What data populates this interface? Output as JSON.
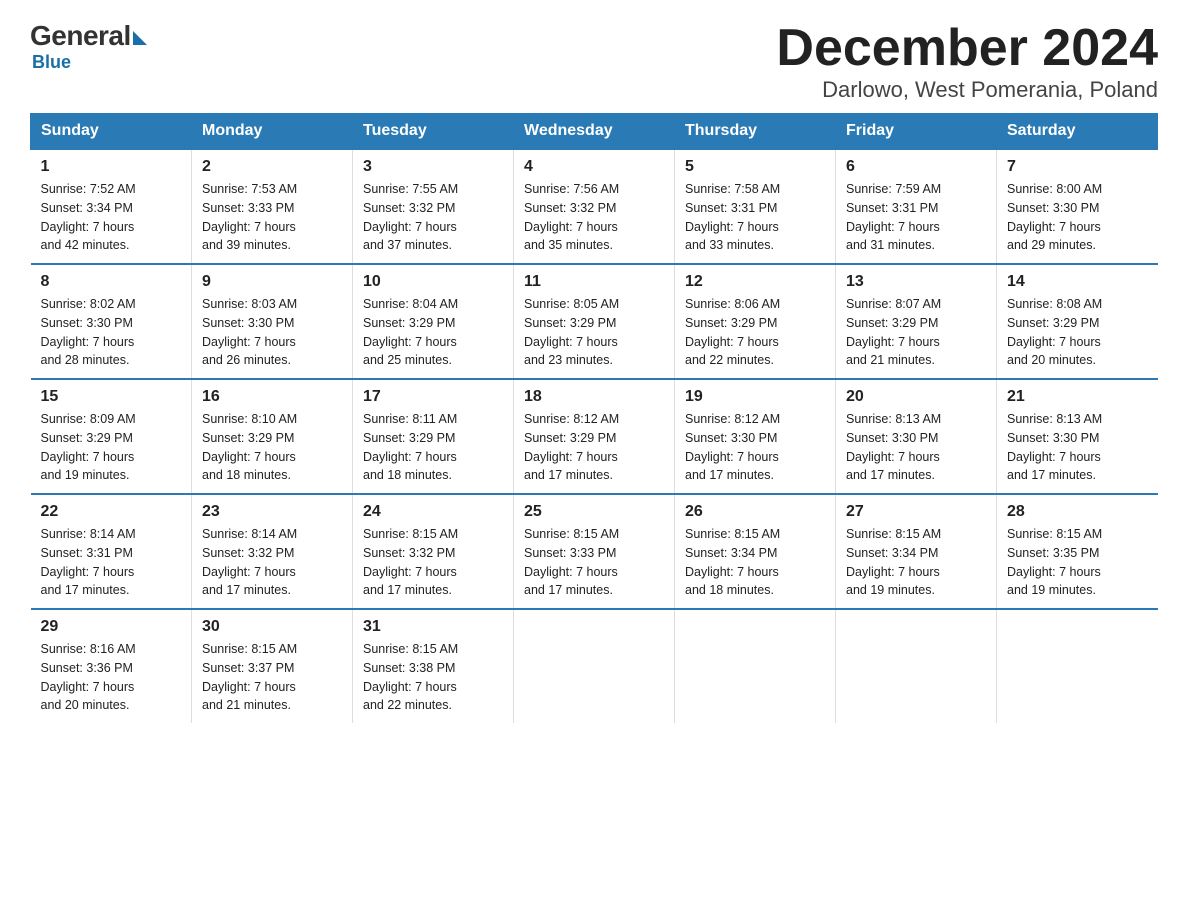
{
  "logo": {
    "general": "General",
    "blue": "Blue"
  },
  "title": "December 2024",
  "subtitle": "Darlowo, West Pomerania, Poland",
  "days_of_week": [
    "Sunday",
    "Monday",
    "Tuesday",
    "Wednesday",
    "Thursday",
    "Friday",
    "Saturday"
  ],
  "weeks": [
    [
      {
        "day": "1",
        "sunrise": "7:52 AM",
        "sunset": "3:34 PM",
        "daylight": "7 hours and 42 minutes."
      },
      {
        "day": "2",
        "sunrise": "7:53 AM",
        "sunset": "3:33 PM",
        "daylight": "7 hours and 39 minutes."
      },
      {
        "day": "3",
        "sunrise": "7:55 AM",
        "sunset": "3:32 PM",
        "daylight": "7 hours and 37 minutes."
      },
      {
        "day": "4",
        "sunrise": "7:56 AM",
        "sunset": "3:32 PM",
        "daylight": "7 hours and 35 minutes."
      },
      {
        "day": "5",
        "sunrise": "7:58 AM",
        "sunset": "3:31 PM",
        "daylight": "7 hours and 33 minutes."
      },
      {
        "day": "6",
        "sunrise": "7:59 AM",
        "sunset": "3:31 PM",
        "daylight": "7 hours and 31 minutes."
      },
      {
        "day": "7",
        "sunrise": "8:00 AM",
        "sunset": "3:30 PM",
        "daylight": "7 hours and 29 minutes."
      }
    ],
    [
      {
        "day": "8",
        "sunrise": "8:02 AM",
        "sunset": "3:30 PM",
        "daylight": "7 hours and 28 minutes."
      },
      {
        "day": "9",
        "sunrise": "8:03 AM",
        "sunset": "3:30 PM",
        "daylight": "7 hours and 26 minutes."
      },
      {
        "day": "10",
        "sunrise": "8:04 AM",
        "sunset": "3:29 PM",
        "daylight": "7 hours and 25 minutes."
      },
      {
        "day": "11",
        "sunrise": "8:05 AM",
        "sunset": "3:29 PM",
        "daylight": "7 hours and 23 minutes."
      },
      {
        "day": "12",
        "sunrise": "8:06 AM",
        "sunset": "3:29 PM",
        "daylight": "7 hours and 22 minutes."
      },
      {
        "day": "13",
        "sunrise": "8:07 AM",
        "sunset": "3:29 PM",
        "daylight": "7 hours and 21 minutes."
      },
      {
        "day": "14",
        "sunrise": "8:08 AM",
        "sunset": "3:29 PM",
        "daylight": "7 hours and 20 minutes."
      }
    ],
    [
      {
        "day": "15",
        "sunrise": "8:09 AM",
        "sunset": "3:29 PM",
        "daylight": "7 hours and 19 minutes."
      },
      {
        "day": "16",
        "sunrise": "8:10 AM",
        "sunset": "3:29 PM",
        "daylight": "7 hours and 18 minutes."
      },
      {
        "day": "17",
        "sunrise": "8:11 AM",
        "sunset": "3:29 PM",
        "daylight": "7 hours and 18 minutes."
      },
      {
        "day": "18",
        "sunrise": "8:12 AM",
        "sunset": "3:29 PM",
        "daylight": "7 hours and 17 minutes."
      },
      {
        "day": "19",
        "sunrise": "8:12 AM",
        "sunset": "3:30 PM",
        "daylight": "7 hours and 17 minutes."
      },
      {
        "day": "20",
        "sunrise": "8:13 AM",
        "sunset": "3:30 PM",
        "daylight": "7 hours and 17 minutes."
      },
      {
        "day": "21",
        "sunrise": "8:13 AM",
        "sunset": "3:30 PM",
        "daylight": "7 hours and 17 minutes."
      }
    ],
    [
      {
        "day": "22",
        "sunrise": "8:14 AM",
        "sunset": "3:31 PM",
        "daylight": "7 hours and 17 minutes."
      },
      {
        "day": "23",
        "sunrise": "8:14 AM",
        "sunset": "3:32 PM",
        "daylight": "7 hours and 17 minutes."
      },
      {
        "day": "24",
        "sunrise": "8:15 AM",
        "sunset": "3:32 PM",
        "daylight": "7 hours and 17 minutes."
      },
      {
        "day": "25",
        "sunrise": "8:15 AM",
        "sunset": "3:33 PM",
        "daylight": "7 hours and 17 minutes."
      },
      {
        "day": "26",
        "sunrise": "8:15 AM",
        "sunset": "3:34 PM",
        "daylight": "7 hours and 18 minutes."
      },
      {
        "day": "27",
        "sunrise": "8:15 AM",
        "sunset": "3:34 PM",
        "daylight": "7 hours and 19 minutes."
      },
      {
        "day": "28",
        "sunrise": "8:15 AM",
        "sunset": "3:35 PM",
        "daylight": "7 hours and 19 minutes."
      }
    ],
    [
      {
        "day": "29",
        "sunrise": "8:16 AM",
        "sunset": "3:36 PM",
        "daylight": "7 hours and 20 minutes."
      },
      {
        "day": "30",
        "sunrise": "8:15 AM",
        "sunset": "3:37 PM",
        "daylight": "7 hours and 21 minutes."
      },
      {
        "day": "31",
        "sunrise": "8:15 AM",
        "sunset": "3:38 PM",
        "daylight": "7 hours and 22 minutes."
      },
      null,
      null,
      null,
      null
    ]
  ],
  "labels": {
    "sunrise": "Sunrise:",
    "sunset": "Sunset:",
    "daylight": "Daylight:"
  }
}
